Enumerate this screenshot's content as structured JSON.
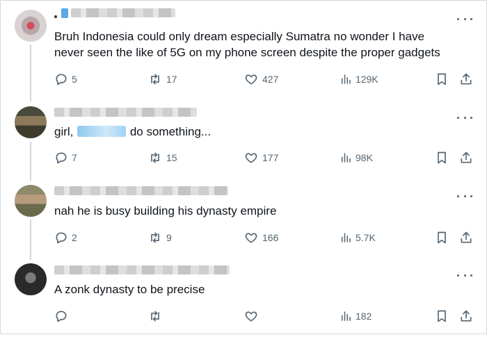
{
  "tweets": [
    {
      "text": "Bruh Indonesia could only dream especially Sumatra no wonder I have\nnever seen the like of 5G on my phone screen despite the proper gadgets",
      "stats": {
        "replies": "5",
        "reposts": "17",
        "likes": "427",
        "views": "129K"
      }
    },
    {
      "text_before": "girl, ",
      "text_after": " do something...",
      "stats": {
        "replies": "7",
        "reposts": "15",
        "likes": "177",
        "views": "98K"
      }
    },
    {
      "text": "nah he is busy building his dynasty empire",
      "stats": {
        "replies": "2",
        "reposts": "9",
        "likes": "166",
        "views": "5.7K"
      }
    },
    {
      "text": "A zonk dynasty to be precise",
      "stats": {
        "replies": "",
        "reposts": "",
        "likes": "",
        "views": "182"
      }
    }
  ],
  "icons": {
    "reply": "reply-icon",
    "repost": "repost-icon",
    "like": "like-icon",
    "views": "views-icon",
    "bookmark": "bookmark-icon",
    "share": "share-icon",
    "more": "more-icon"
  },
  "colors": {
    "icon": "#536471",
    "text": "#0f1419",
    "border": "#cfd9de"
  }
}
